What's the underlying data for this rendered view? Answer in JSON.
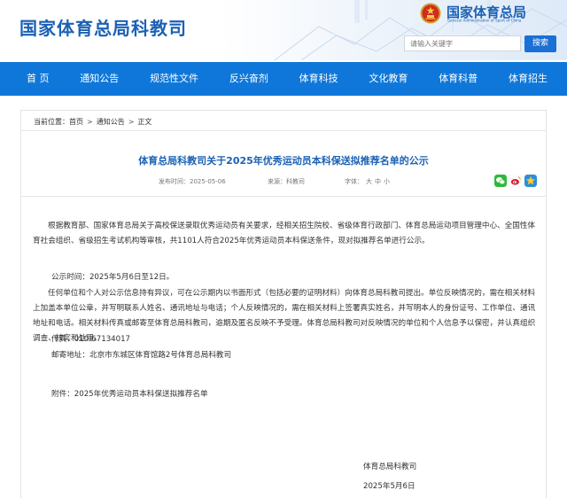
{
  "header": {
    "site_title": "国家体育总局科教司",
    "brand_cn": "国家体育总局",
    "brand_en": "General Administration of Sport of China",
    "search_placeholder": "请输入关键字",
    "search_button": "搜索"
  },
  "nav": {
    "items": [
      "首 页",
      "通知公告",
      "规范性文件",
      "反兴奋剂",
      "体育科技",
      "文化教育",
      "体育科普",
      "体育招生"
    ]
  },
  "breadcrumb": {
    "prefix": "当前位置：",
    "items": [
      "首页",
      "通知公告",
      "正文"
    ],
    "separator": ">"
  },
  "article": {
    "title": "体育总局科教司关于2025年优秀运动员本科保送拟推荐名单的公示",
    "meta": {
      "date_label": "发布时间：",
      "date": "2025-05-06",
      "source_label": "来源：",
      "source": "科教司",
      "size_label": "字体：",
      "size_options": [
        "大",
        "中",
        "小"
      ]
    },
    "share_icons": [
      "wechat-icon",
      "weibo-icon",
      "qzone-icon"
    ],
    "paragraphs": [
      "根据教育部、国家体育总局关于高校保送录取优秀运动员有关要求，经相关招生院校、省级体育行政部门、体育总局运动项目管理中心、全国性体育社会组织、省级招生考试机构等审核，共1101人符合2025年优秀运动员本科保送条件，现对拟推荐名单进行公示。",
      "公示时间：2025年5月6日至12日。",
      "任何单位和个人对公示信息持有异议，可在公示期内以书面形式（包括必要的证明材料）向体育总局科教司提出。单位反映情况的，需在相关材料上加盖本单位公章，并写明联系人姓名、通讯地址与电话；个人反映情况的，需在相关材料上签署真实姓名，并写明本人的身份证号、工作单位、通讯地址和电话。相关材料传真或邮寄至体育总局科教司，逾期及匿名反映不予受理。体育总局科教司对反映情况的单位和个人信息予以保密，并认真组织调查、核实和处理。",
      "传真：010-67134017",
      "邮寄地址：北京市东城区体育馆路2号体育总局科教司",
      "附件：2025年优秀运动员本科保送拟推荐名单"
    ],
    "signature": "体育总局科教司",
    "signature_date": "2025年5月6日"
  },
  "colors": {
    "brand_blue": "#1b61b5",
    "nav_blue": "#0f77d9",
    "search_blue": "#1b70d5"
  }
}
